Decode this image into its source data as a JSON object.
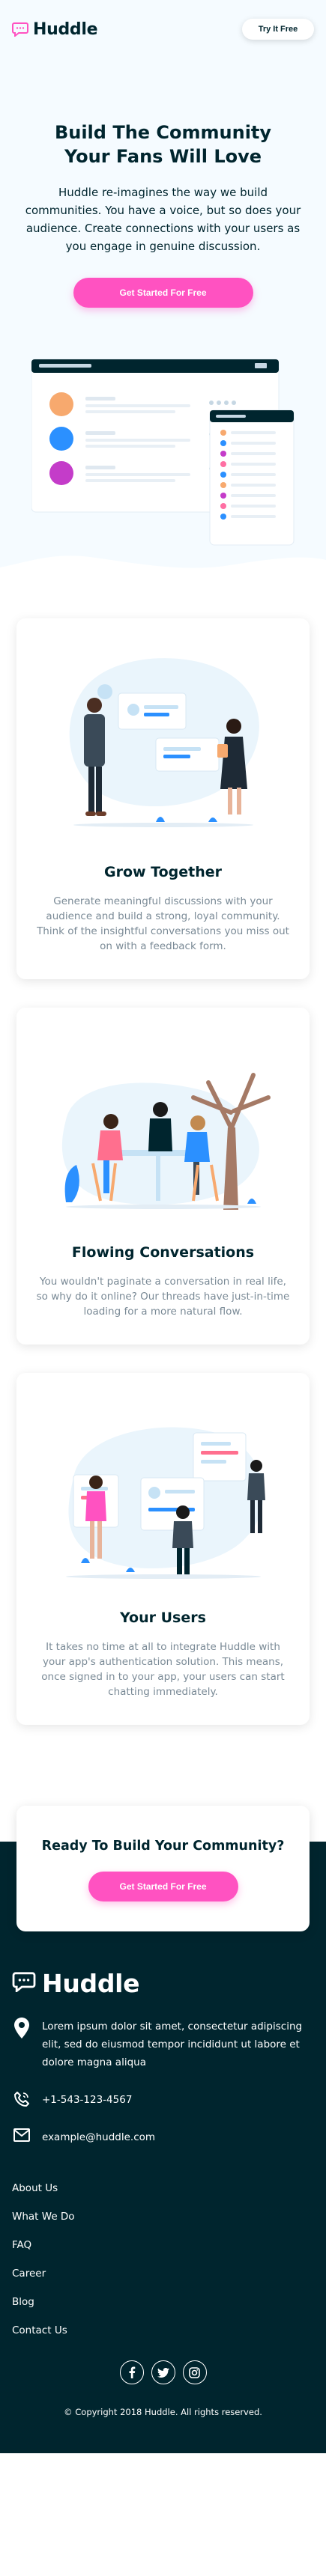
{
  "header": {
    "logo_text": "Huddle",
    "try_button": "Try It Free"
  },
  "hero": {
    "title": "Build The Community Your Fans Will Love",
    "description": "Huddle re-imagines the way we build communities. You have a voice, but so does your audience. Create connections with your users as you engage in genuine discussion.",
    "cta": "Get Started For Free"
  },
  "features": [
    {
      "title": "Grow Together",
      "description": "Generate meaningful discussions with your audience and build a strong, loyal community. Think of the insightful conversations you miss out on with a feedback form."
    },
    {
      "title": "Flowing Conversations",
      "description": "You wouldn't paginate a conversation in real life, so why do it online? Our threads have just-in-time loading for a more natural flow."
    },
    {
      "title": "Your Users",
      "description": "It takes no time at all to integrate Huddle with your app's authentication solution. This means, once signed in to your app, your users can start chatting immediately."
    }
  ],
  "ready": {
    "title": "Ready To Build Your Community?",
    "cta": "Get Started For Free"
  },
  "footer": {
    "logo_text": "Huddle",
    "address": "Lorem ipsum dolor sit amet, consectetur adipiscing elit, sed do eiusmod tempor incididunt ut labore et dolore magna aliqua",
    "phone": "+1-543-123-4567",
    "email": "example@huddle.com",
    "links": [
      "About Us",
      "What We Do",
      "FAQ",
      "Career",
      "Blog",
      "Contact Us"
    ],
    "social_icons": [
      "facebook-icon",
      "twitter-icon",
      "instagram-icon"
    ],
    "copyright": "© Copyright 2018 Huddle. All rights reserved."
  },
  "colors": {
    "primary_dark": "#00252e",
    "accent_pink": "#ff52c1",
    "hero_bg": "#f5fbff",
    "text_gray": "#7a8a96"
  }
}
